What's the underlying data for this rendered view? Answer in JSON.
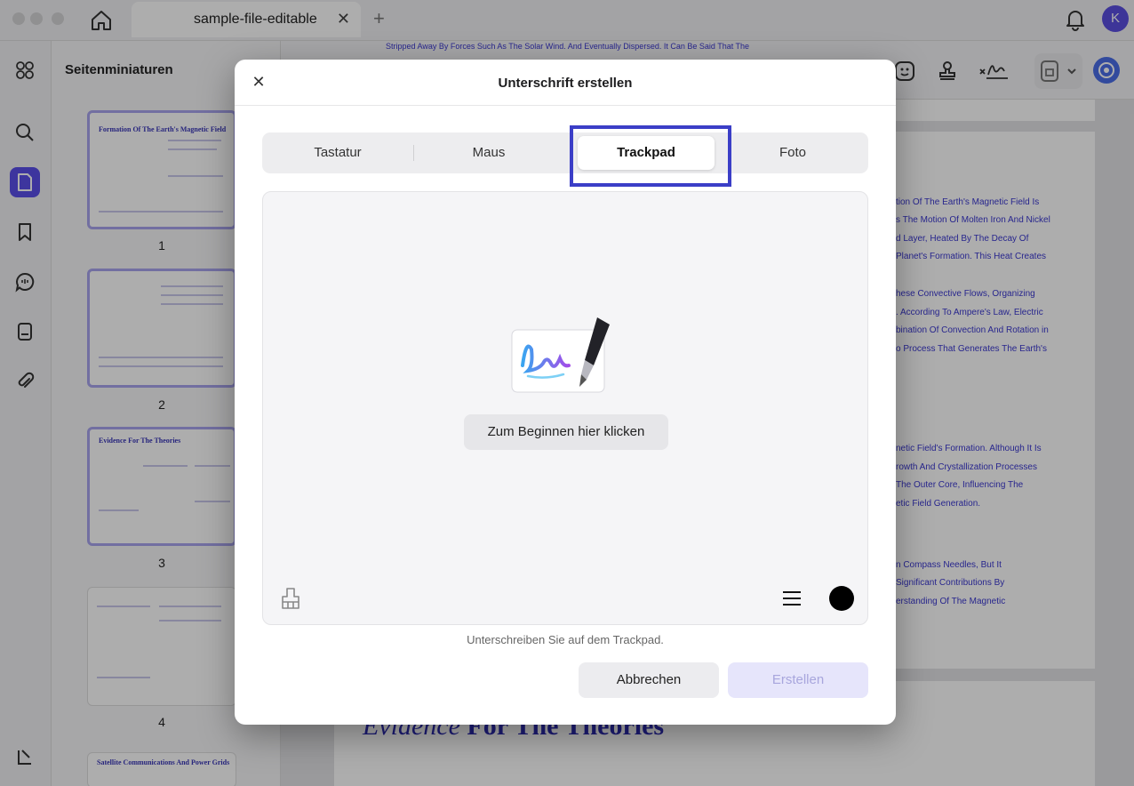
{
  "window": {
    "tab_title": "sample-file-editable",
    "tab_close": "✕",
    "tab_add": "+",
    "avatar_letter": "K"
  },
  "sidebar": {
    "title": "Seitenminiaturen",
    "thumbnails": [
      {
        "number": "1",
        "heading": "Formation Of The Earth's Magnetic Field"
      },
      {
        "number": "2",
        "heading": ""
      },
      {
        "number": "3",
        "heading": "Evidence For The Theories"
      },
      {
        "number": "4",
        "heading": ""
      }
    ],
    "next_thumb_heading": "Satellite Communications And Power Grids"
  },
  "document": {
    "top_cut_line": "Stripped Away By Forces Such As The Solar Wind. And Eventually Dispersed. It Can Be Said That The",
    "right_lines_a": [
      "tion Of The Earth's Magnetic Field Is",
      "s The Motion Of Molten Iron And Nickel",
      "d Layer, Heated By The Decay Of",
      "Planet's Formation. This Heat Creates",
      "hese Convective Flows, Organizing",
      ". According To Ampere's Law, Electric",
      "bination Of Convection And Rotation in",
      "o Process That Generates The Earth's"
    ],
    "right_lines_b": [
      "netic Field's Formation. Although It Is",
      "rowth And Crystallization Processes",
      "The Outer Core, Influencing The",
      "etic Field Generation."
    ],
    "right_lines_c": [
      "n Compass Needles, But It",
      "Significant Contributions By",
      "erstanding Of The Magnetic"
    ],
    "bottom_heading_italic": "Evidence",
    "bottom_heading_bold": "For The Theories"
  },
  "dialog": {
    "title": "Unterschrift erstellen",
    "close_label": "✕",
    "tabs": [
      {
        "label": "Tastatur",
        "selected": false
      },
      {
        "label": "Maus",
        "selected": false
      },
      {
        "label": "Trackpad",
        "selected": true
      },
      {
        "label": "Foto",
        "selected": false
      }
    ],
    "start_button": "Zum Beginnen hier klicken",
    "hint": "Unterschreiben Sie auf dem Trackpad.",
    "cancel_button": "Abbrechen",
    "create_button": "Erstellen",
    "pen_color": "#000000",
    "accent": "#5b4fe9",
    "highlight_color": "#3b3ec7"
  }
}
